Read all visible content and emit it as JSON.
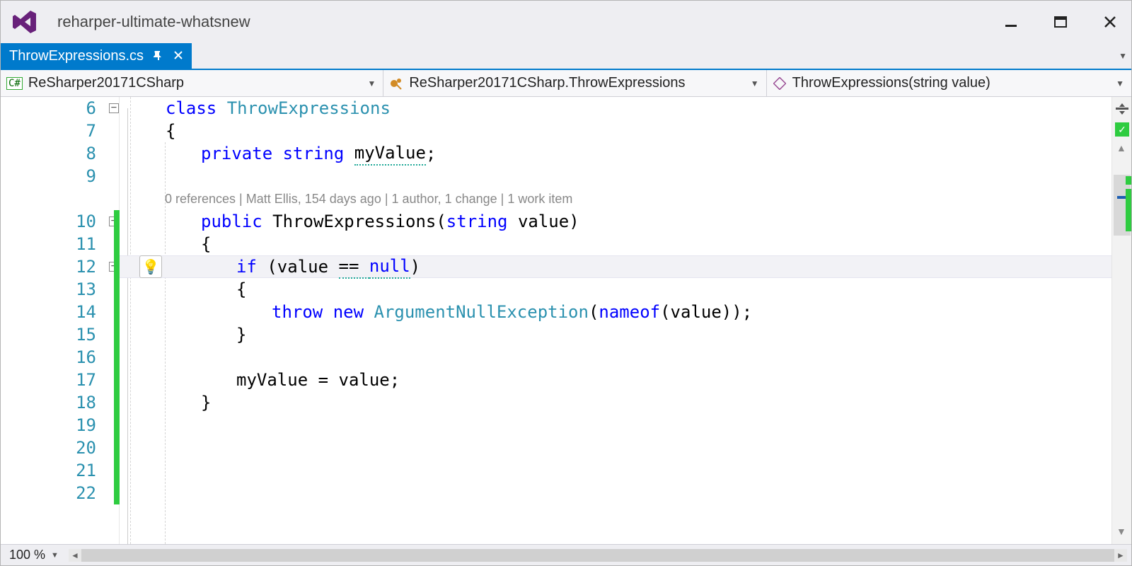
{
  "title": "reharper-ultimate-whatsnew",
  "tab": {
    "filename": "ThrowExpressions.cs"
  },
  "nav": {
    "namespace": "ReSharper20171CSharp",
    "class": "ReSharper20171CSharp.ThrowExpressions",
    "member": "ThrowExpressions(string value)"
  },
  "codelens": "0 references | Matt Ellis, 154 days ago | 1 author, 1 change | 1 work item",
  "lines": {
    "6": {
      "indent": 1,
      "tokens": [
        [
          "kw",
          "class "
        ],
        [
          "type",
          "ThrowExpressions"
        ]
      ],
      "fold": true
    },
    "7": {
      "indent": 1,
      "tokens": [
        [
          "ident",
          "{"
        ]
      ]
    },
    "8": {
      "indent": 2,
      "tokens": [
        [
          "kw",
          "private "
        ],
        [
          "kw",
          "string "
        ],
        [
          "ident squiggle",
          "myValue"
        ],
        [
          "ident",
          ";"
        ]
      ]
    },
    "9": {
      "indent": 2,
      "tokens": []
    },
    "10": {
      "indent": 2,
      "tokens": [
        [
          "kw",
          "public "
        ],
        [
          "ident",
          "ThrowExpressions("
        ],
        [
          "kw",
          "string "
        ],
        [
          "ident",
          "value)"
        ]
      ],
      "fold": true,
      "changed": true
    },
    "11": {
      "indent": 2,
      "tokens": [
        [
          "ident",
          "{"
        ]
      ],
      "changed": true
    },
    "12": {
      "indent": 3,
      "tokens": [
        [
          "kw",
          "if "
        ],
        [
          "ident",
          "(value "
        ],
        [
          "ident squiggle",
          "== "
        ],
        [
          "kw squiggle",
          "null"
        ],
        [
          "ident",
          ")"
        ]
      ],
      "fold": true,
      "changed": true,
      "highlight": true,
      "bulb": true
    },
    "13": {
      "indent": 3,
      "tokens": [
        [
          "ident",
          "{"
        ]
      ],
      "changed": true
    },
    "14": {
      "indent": 4,
      "tokens": [
        [
          "kw",
          "throw "
        ],
        [
          "kw",
          "new "
        ],
        [
          "type",
          "ArgumentNullException"
        ],
        [
          "ident",
          "("
        ],
        [
          "kw",
          "nameof"
        ],
        [
          "ident",
          "(value));"
        ]
      ],
      "changed": true
    },
    "15": {
      "indent": 3,
      "tokens": [
        [
          "ident",
          "}"
        ]
      ],
      "changed": true
    },
    "16": {
      "indent": 0,
      "tokens": [],
      "changed": true
    },
    "17": {
      "indent": 3,
      "tokens": [
        [
          "ident",
          "myValue = value;"
        ]
      ],
      "changed": true
    },
    "18": {
      "indent": 2,
      "tokens": [
        [
          "ident",
          "}"
        ]
      ],
      "changed": true
    },
    "19": {
      "indent": 0,
      "tokens": [],
      "changed": true
    },
    "20": {
      "indent": 0,
      "tokens": [],
      "changed": true
    },
    "21": {
      "indent": 0,
      "tokens": [],
      "changed": true
    },
    "22": {
      "indent": 0,
      "tokens": [],
      "changed": true
    }
  },
  "line_order": [
    "6",
    "7",
    "8",
    "9",
    "codelens",
    "10",
    "11",
    "12",
    "13",
    "14",
    "15",
    "16",
    "17",
    "18",
    "19",
    "20",
    "21",
    "22"
  ],
  "zoom": "100 %"
}
